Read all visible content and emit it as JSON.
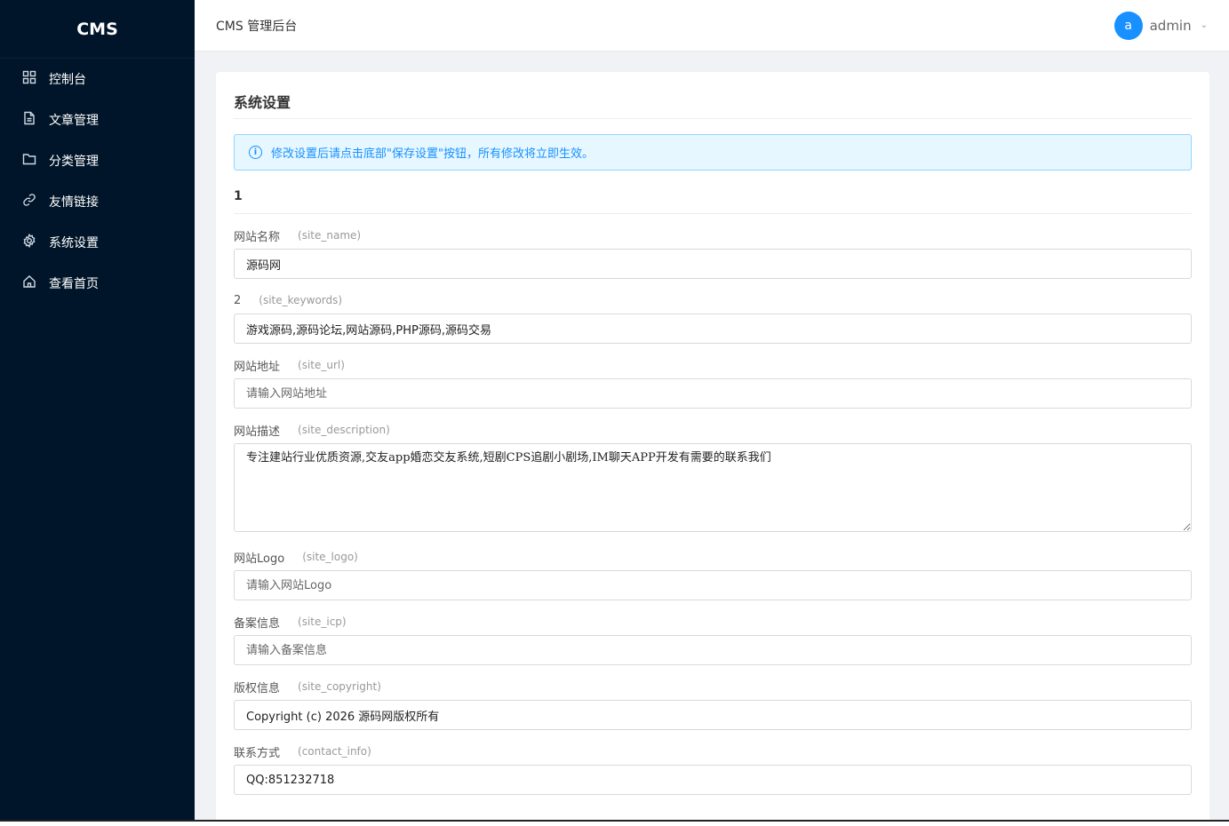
{
  "sidebar": {
    "brand": "CMS",
    "items": [
      {
        "label": "控制台",
        "icon": "dashboard-icon"
      },
      {
        "label": "文章管理",
        "icon": "file-icon"
      },
      {
        "label": "分类管理",
        "icon": "folder-icon"
      },
      {
        "label": "友情链接",
        "icon": "link-icon"
      },
      {
        "label": "系统设置",
        "icon": "gear-icon"
      },
      {
        "label": "查看首页",
        "icon": "home-icon"
      }
    ]
  },
  "header": {
    "title": "CMS 管理后台",
    "avatar_letter": "a",
    "username": "admin",
    "caret": "⌄"
  },
  "main": {
    "title": "系统设置",
    "alert": "修改设置后请点击底部\"保存设置\"按钮，所有修改将立即生效。",
    "section_title": "1",
    "fields": [
      {
        "label": "网站名称",
        "key": "(site_name)",
        "value": "源码网",
        "placeholder": ""
      },
      {
        "label": "2",
        "key": "(site_keywords)",
        "value": "游戏源码,源码论坛,网站源码,PHP源码,源码交易",
        "placeholder": ""
      },
      {
        "label": "网站地址",
        "key": "(site_url)",
        "value": "",
        "placeholder": "请输入网站地址"
      },
      {
        "label": "网站描述",
        "key": "(site_description)",
        "value": "专注建站行业优质资源,交友app婚恋交友系统,短剧CPS追剧小剧场,IM聊天APP开发有需要的联系我们",
        "placeholder": ""
      },
      {
        "label": "网站Logo",
        "key": "(site_logo)",
        "value": "",
        "placeholder": "请输入网站Logo"
      },
      {
        "label": "备案信息",
        "key": "(site_icp)",
        "value": "",
        "placeholder": "请输入备案信息"
      },
      {
        "label": "版权信息",
        "key": "(site_copyright)",
        "value": "Copyright (c) 2026 源码网版权所有",
        "placeholder": ""
      },
      {
        "label": "联系方式",
        "key": "(contact_info)",
        "value": "QQ:851232718",
        "placeholder": ""
      }
    ]
  },
  "colors": {
    "sidebar_bg": "#001529",
    "accent": "#1890ff",
    "alert_bg": "#e6f7ff",
    "page_bg": "#f0f2f5"
  }
}
